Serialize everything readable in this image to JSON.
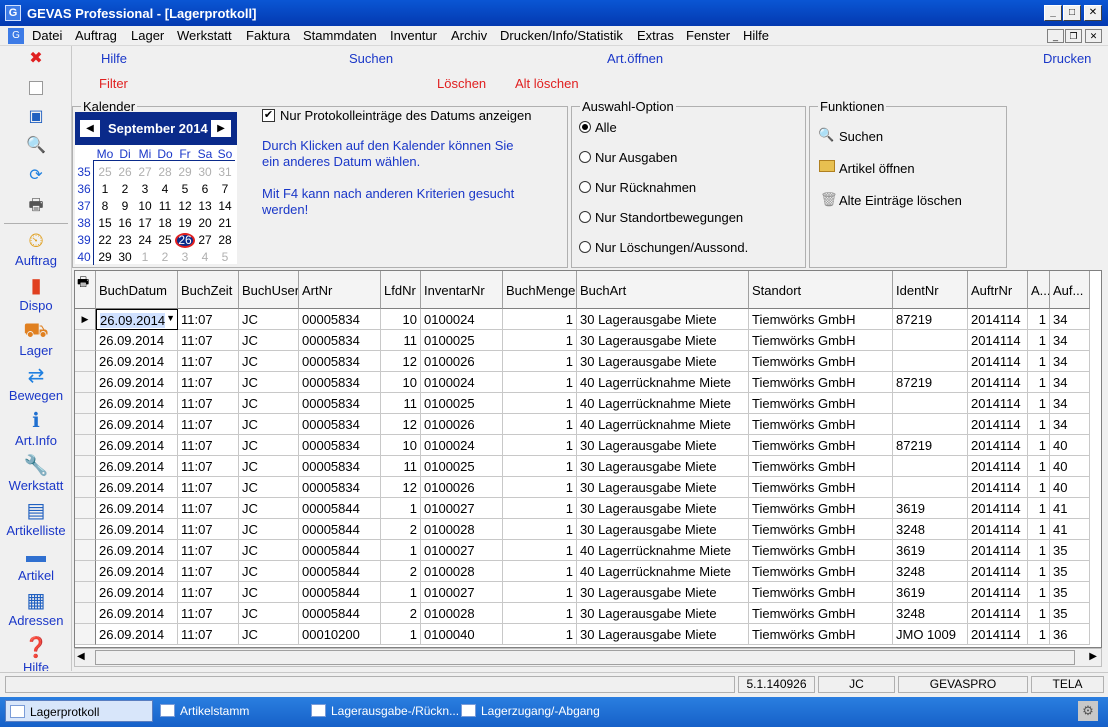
{
  "window": {
    "title": "GEVAS Professional - [Lagerprotkoll]"
  },
  "menu": [
    "Datei",
    "Auftrag",
    "Lager",
    "Werkstatt",
    "Faktura",
    "Stammdaten",
    "Inventur",
    "Archiv",
    "Drucken/Info/Statistik",
    "Extras",
    "Fenster",
    "Hilfe"
  ],
  "toolbar": {
    "hilfe": "Hilfe",
    "suchen": "Suchen",
    "art_oeffnen": "Art.öffnen",
    "drucken": "Drucken",
    "filter": "Filter",
    "loeschen": "Löschen",
    "alt_loeschen": "Alt löschen"
  },
  "sidebar": [
    "Auftrag",
    "Dispo",
    "Lager",
    "Bewegen",
    "Art.Info",
    "Werkstatt",
    "Artikelliste",
    "Artikel",
    "Adressen",
    "Hilfe"
  ],
  "calendar": {
    "group_label": "Kalender",
    "month": "September 2014",
    "weekdays": [
      "Mo",
      "Di",
      "Mi",
      "Do",
      "Fr",
      "Sa",
      "So"
    ],
    "weeks": [
      "35",
      "36",
      "37",
      "38",
      "39",
      "40"
    ],
    "days": [
      [
        "25",
        "26",
        "27",
        "28",
        "29",
        "30",
        "31"
      ],
      [
        "1",
        "2",
        "3",
        "4",
        "5",
        "6",
        "7"
      ],
      [
        "8",
        "9",
        "10",
        "11",
        "12",
        "13",
        "14"
      ],
      [
        "15",
        "16",
        "17",
        "18",
        "19",
        "20",
        "21"
      ],
      [
        "22",
        "23",
        "24",
        "25",
        "26",
        "27",
        "28"
      ],
      [
        "29",
        "30",
        "1",
        "2",
        "3",
        "4",
        "5"
      ]
    ]
  },
  "info": {
    "checkbox_label": "Nur Protokolleinträge des Datums anzeigen",
    "hint1a": "Durch Klicken auf den Kalender können Sie",
    "hint1b": "ein anderes Datum wählen.",
    "hint2a": "Mit F4 kann nach anderen Kriterien gesucht",
    "hint2b": "werden!"
  },
  "auswahl": {
    "label": "Auswahl-Option",
    "options": [
      "Alle",
      "Nur Ausgaben",
      "Nur Rücknahmen",
      "Nur Standortbewegungen",
      "Nur Löschungen/Aussond."
    ]
  },
  "funktionen": {
    "label": "Funktionen",
    "items": [
      "Suchen",
      "Artikel öffnen",
      "Alte Einträge löschen"
    ]
  },
  "table": {
    "columns": [
      "BuchDatum",
      "BuchZeit",
      "BuchUser",
      "ArtNr",
      "LfdNr",
      "InventarNr",
      "BuchMenge",
      "BuchArt",
      "Standort",
      "IdentNr",
      "AuftrNr",
      "A...",
      "Auf..."
    ],
    "rows": [
      [
        "26.09.2014",
        "11:07",
        "JC",
        "00005834",
        "10",
        "0100024",
        "1",
        "30 Lagerausgabe Miete",
        "Tiemwörks GmbH",
        "87219",
        "2014114",
        "1",
        "34"
      ],
      [
        "26.09.2014",
        "11:07",
        "JC",
        "00005834",
        "11",
        "0100025",
        "1",
        "30 Lagerausgabe Miete",
        "Tiemwörks GmbH",
        "",
        "2014114",
        "1",
        "34"
      ],
      [
        "26.09.2014",
        "11:07",
        "JC",
        "00005834",
        "12",
        "0100026",
        "1",
        "30 Lagerausgabe Miete",
        "Tiemwörks GmbH",
        "",
        "2014114",
        "1",
        "34"
      ],
      [
        "26.09.2014",
        "11:07",
        "JC",
        "00005834",
        "10",
        "0100024",
        "1",
        "40 Lagerrücknahme Miete",
        "Tiemwörks GmbH",
        "87219",
        "2014114",
        "1",
        "34"
      ],
      [
        "26.09.2014",
        "11:07",
        "JC",
        "00005834",
        "11",
        "0100025",
        "1",
        "40 Lagerrücknahme Miete",
        "Tiemwörks GmbH",
        "",
        "2014114",
        "1",
        "34"
      ],
      [
        "26.09.2014",
        "11:07",
        "JC",
        "00005834",
        "12",
        "0100026",
        "1",
        "40 Lagerrücknahme Miete",
        "Tiemwörks GmbH",
        "",
        "2014114",
        "1",
        "34"
      ],
      [
        "26.09.2014",
        "11:07",
        "JC",
        "00005834",
        "10",
        "0100024",
        "1",
        "30 Lagerausgabe Miete",
        "Tiemwörks GmbH",
        "87219",
        "2014114",
        "1",
        "40"
      ],
      [
        "26.09.2014",
        "11:07",
        "JC",
        "00005834",
        "11",
        "0100025",
        "1",
        "30 Lagerausgabe Miete",
        "Tiemwörks GmbH",
        "",
        "2014114",
        "1",
        "40"
      ],
      [
        "26.09.2014",
        "11:07",
        "JC",
        "00005834",
        "12",
        "0100026",
        "1",
        "30 Lagerausgabe Miete",
        "Tiemwörks GmbH",
        "",
        "2014114",
        "1",
        "40"
      ],
      [
        "26.09.2014",
        "11:07",
        "JC",
        "00005844",
        "1",
        "0100027",
        "1",
        "30 Lagerausgabe Miete",
        "Tiemwörks GmbH",
        "3619",
        "2014114",
        "1",
        "41"
      ],
      [
        "26.09.2014",
        "11:07",
        "JC",
        "00005844",
        "2",
        "0100028",
        "1",
        "30 Lagerausgabe Miete",
        "Tiemwörks GmbH",
        "3248",
        "2014114",
        "1",
        "41"
      ],
      [
        "26.09.2014",
        "11:07",
        "JC",
        "00005844",
        "1",
        "0100027",
        "1",
        "40 Lagerrücknahme Miete",
        "Tiemwörks GmbH",
        "3619",
        "2014114",
        "1",
        "35"
      ],
      [
        "26.09.2014",
        "11:07",
        "JC",
        "00005844",
        "2",
        "0100028",
        "1",
        "40 Lagerrücknahme Miete",
        "Tiemwörks GmbH",
        "3248",
        "2014114",
        "1",
        "35"
      ],
      [
        "26.09.2014",
        "11:07",
        "JC",
        "00005844",
        "1",
        "0100027",
        "1",
        "30 Lagerausgabe Miete",
        "Tiemwörks GmbH",
        "3619",
        "2014114",
        "1",
        "35"
      ],
      [
        "26.09.2014",
        "11:07",
        "JC",
        "00005844",
        "2",
        "0100028",
        "1",
        "30 Lagerausgabe Miete",
        "Tiemwörks GmbH",
        "3248",
        "2014114",
        "1",
        "35"
      ],
      [
        "26.09.2014",
        "11:07",
        "JC",
        "00010200",
        "1",
        "0100040",
        "1",
        "30 Lagerausgabe Miete",
        "Tiemwörks GmbH",
        "JMO 1009",
        "2014114",
        "1",
        "36"
      ]
    ]
  },
  "status": {
    "version": "5.1.140926",
    "user": "JC",
    "db": "GEVASPRO",
    "tela": "TELA"
  },
  "taskbar": [
    "Lagerprotkoll",
    "Artikelstamm",
    "Lagerausgabe-/Rückn...",
    "Lagerzugang/-Abgang"
  ]
}
